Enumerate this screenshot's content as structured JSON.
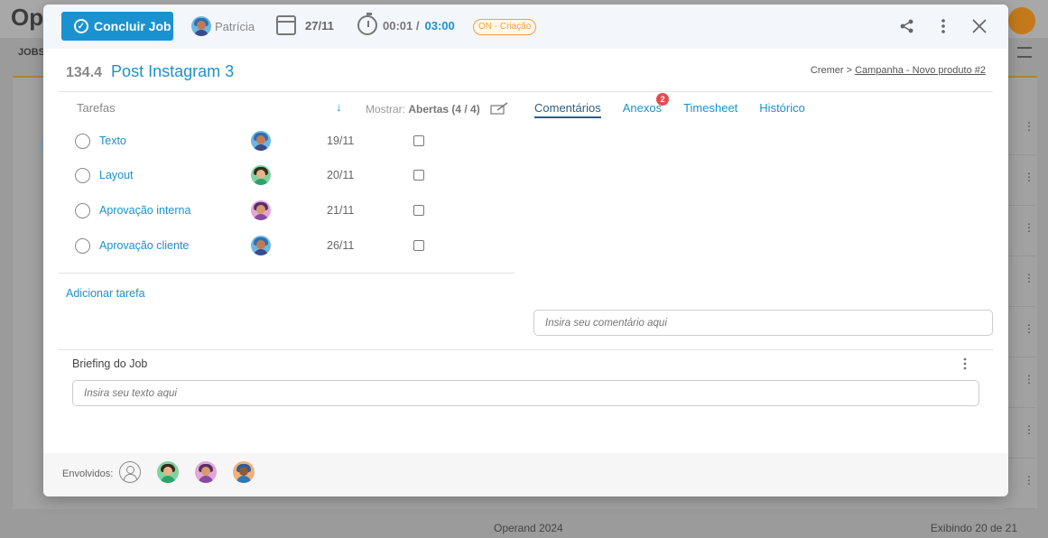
{
  "background": {
    "app_title": "Op",
    "section_label": "JOBS",
    "footer_left": "Operand 2024",
    "footer_right": "Exibindo 20 de 21"
  },
  "header": {
    "conclude_label": "Concluir Job",
    "user_name": "Patrícia",
    "date": "27/11",
    "timer_elapsed": "00:01 /",
    "timer_total": "03:00",
    "status": "ON - Criação",
    "share_icon": "share-icon",
    "menu_icon": "more-vertical-icon",
    "close_icon": "close-icon"
  },
  "job": {
    "number": "134.4",
    "title": "Post Instagram 3",
    "breadcrumb_client": "Cremer >",
    "breadcrumb_project": "Campanha - Novo produto #2"
  },
  "tasks": {
    "heading": "Tarefas",
    "show_label": "Mostrar:",
    "show_value": "Abertas (4 / 4)",
    "add_label": "Adicionar tarefa",
    "items": [
      {
        "name": "Texto",
        "date": "19/11",
        "avatar": "blue"
      },
      {
        "name": "Layout",
        "date": "20/11",
        "avatar": "green"
      },
      {
        "name": "Aprovação interna",
        "date": "21/11",
        "avatar": "pink"
      },
      {
        "name": "Aprovação cliente",
        "date": "26/11",
        "avatar": "blue"
      }
    ]
  },
  "tabs": [
    {
      "label": "Comentários",
      "active": true
    },
    {
      "label": "Anexos",
      "badge": "2"
    },
    {
      "label": "Timesheet"
    },
    {
      "label": "Histórico"
    }
  ],
  "comment": {
    "placeholder": "Insira seu comentário aqui"
  },
  "briefing": {
    "title": "Briefing do Job",
    "placeholder": "Insira seu texto aqui"
  },
  "involved": {
    "label": "Envolvidos:"
  },
  "colors": {
    "primary": "#1a92cf",
    "status": "#f0a040",
    "badge": "#e04d4d"
  }
}
